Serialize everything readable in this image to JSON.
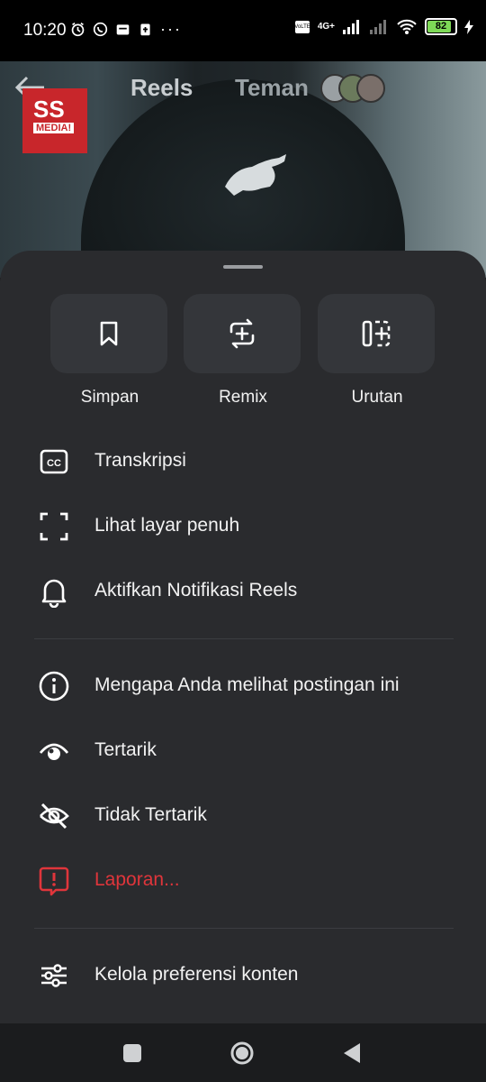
{
  "status_bar": {
    "time": "10:20",
    "network": "4G+",
    "battery": "82"
  },
  "header": {
    "tab_reels": "Reels",
    "tab_friends": "Teman",
    "logo_text": "SS",
    "logo_subtext": "MEDIA!"
  },
  "quick_actions": [
    {
      "label": "Simpan",
      "icon": "bookmark-icon"
    },
    {
      "label": "Remix",
      "icon": "remix-icon"
    },
    {
      "label": "Urutan",
      "icon": "sequence-icon"
    }
  ],
  "menu": {
    "group1": [
      {
        "label": "Transkripsi",
        "icon": "closed-captions-icon"
      },
      {
        "label": "Lihat layar penuh",
        "icon": "fullscreen-icon"
      },
      {
        "label": "Aktifkan Notifikasi Reels",
        "icon": "bell-icon"
      }
    ],
    "group2": [
      {
        "label": "Mengapa Anda melihat postingan ini",
        "icon": "info-icon"
      },
      {
        "label": "Tertarik",
        "icon": "eye-icon"
      },
      {
        "label": "Tidak Tertarik",
        "icon": "eye-off-icon"
      },
      {
        "label": "Laporan...",
        "icon": "report-icon"
      }
    ],
    "group3": [
      {
        "label": "Kelola preferensi konten",
        "icon": "sliders-icon"
      }
    ]
  },
  "colors": {
    "sheet_bg": "#2a2b2e",
    "danger": "#e0353b",
    "tile_bg": "#34363a"
  }
}
